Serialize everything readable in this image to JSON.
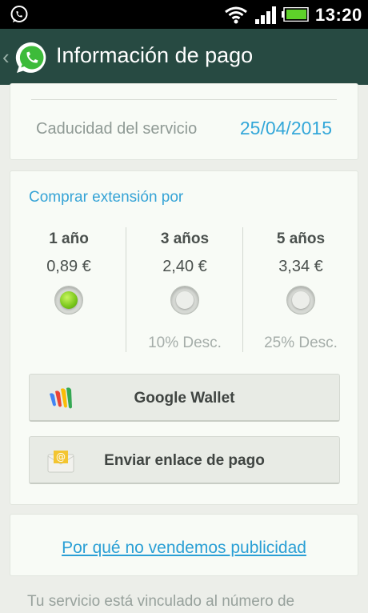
{
  "status_bar": {
    "time": "13:20"
  },
  "header": {
    "title": "Información de pago"
  },
  "service": {
    "expiry_label": "Caducidad del servicio",
    "expiry_value": "25/04/2015"
  },
  "extension": {
    "heading": "Comprar extensión por",
    "options": [
      {
        "period": "1 año",
        "price": "0,89 €",
        "discount": "",
        "selected": true
      },
      {
        "period": "3 años",
        "price": "2,40 €",
        "discount": "10% Desc.",
        "selected": false
      },
      {
        "period": "5 años",
        "price": "3,34 €",
        "discount": "25% Desc.",
        "selected": false
      }
    ]
  },
  "buttons": {
    "google_wallet": "Google Wallet",
    "send_link": "Enviar enlace de pago"
  },
  "ads_link": "Por qué no vendemos publicidad",
  "footer_text": "Tu servicio está vinculado al número de",
  "colors": {
    "accent_blue": "#33a7d9",
    "action_bar": "#274a42",
    "radio_selected": "#78c51a"
  }
}
